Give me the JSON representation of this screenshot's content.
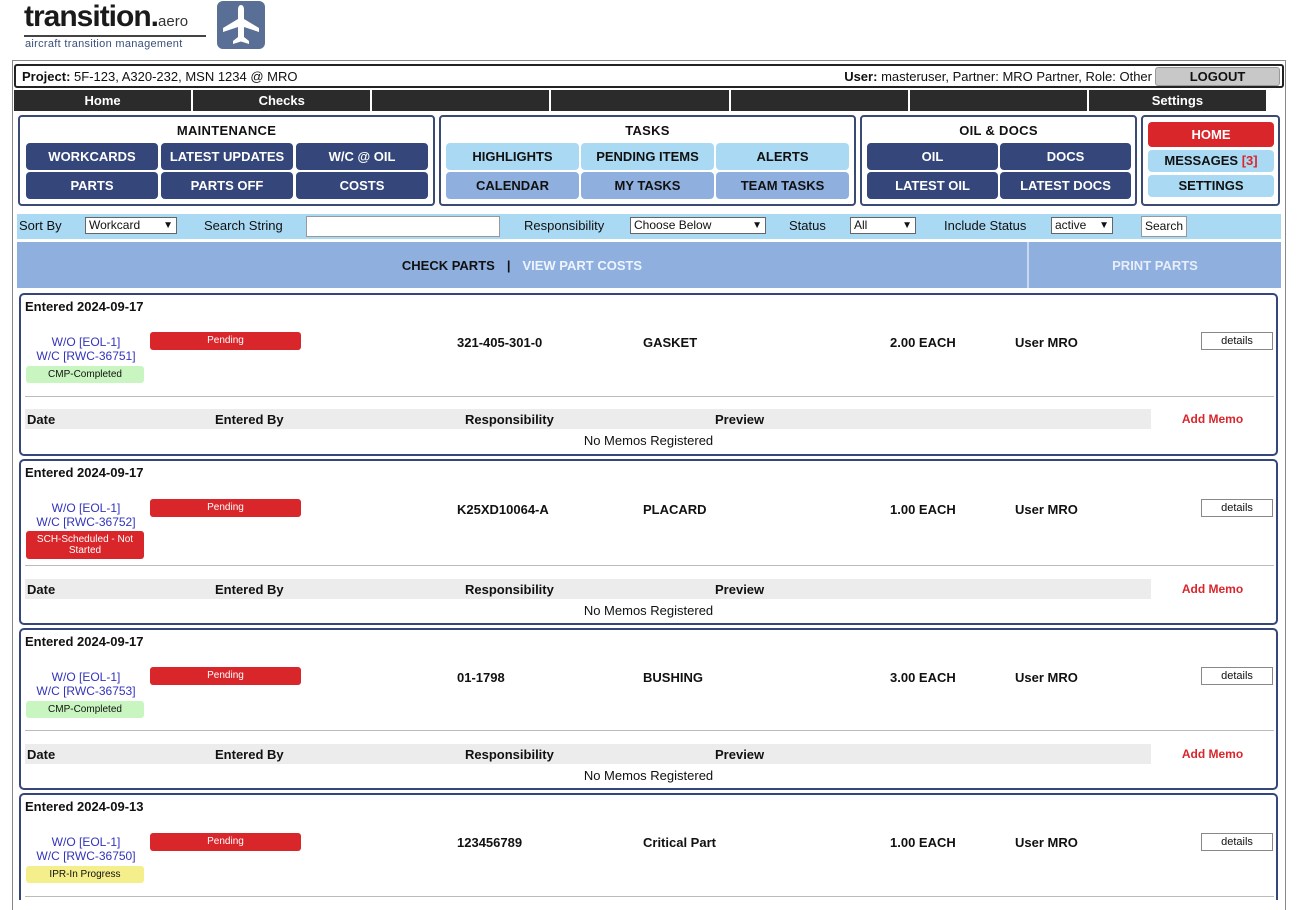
{
  "logo": {
    "word": "transition.",
    "suffix": "aero",
    "tagline": "aircraft transition management"
  },
  "project_bar": {
    "project_label": "Project:",
    "project_value": "5F-123, A320-232, MSN 1234 @ MRO",
    "user_label": "User:",
    "user_value": "masteruser, Partner: MRO Partner, Role: Other",
    "logout": "LOGOUT"
  },
  "nav": [
    "Home",
    "Checks",
    "",
    "",
    "",
    "",
    "Settings"
  ],
  "maintenance": {
    "title": "MAINTENANCE",
    "buttons": [
      "WORKCARDS",
      "LATEST UPDATES",
      "W/C @ OIL",
      "PARTS",
      "PARTS OFF",
      "COSTS"
    ]
  },
  "tasks": {
    "title": "TASKS",
    "buttons": [
      "HIGHLIGHTS",
      "PENDING ITEMS",
      "ALERTS",
      "CALENDAR",
      "MY TASKS",
      "TEAM TASKS"
    ]
  },
  "oil_docs": {
    "title": "OIL & DOCS",
    "buttons": [
      "OIL",
      "DOCS",
      "LATEST OIL",
      "LATEST DOCS"
    ]
  },
  "home_panel": {
    "home": "HOME",
    "messages": "MESSAGES",
    "messages_count": "[3]",
    "settings": "SETTINGS"
  },
  "filters": {
    "sort_by_label": "Sort By",
    "sort_by_value": "Workcard",
    "search_label": "Search String",
    "search_value": "",
    "responsibility_label": "Responsibility",
    "responsibility_value": "Choose Below",
    "status_label": "Status",
    "status_value": "All",
    "include_label": "Include Status",
    "include_value": "active",
    "search_button": "Search"
  },
  "tabs": {
    "check_parts": "CHECK PARTS",
    "separator": "|",
    "view_costs": "VIEW PART COSTS",
    "print_parts": "PRINT PARTS"
  },
  "memo_headers": {
    "date": "Date",
    "entered_by": "Entered By",
    "responsibility": "Responsibility",
    "preview": "Preview",
    "add_memo": "Add Memo",
    "no_memos": "No Memos Registered"
  },
  "parts": [
    {
      "entered": "Entered 2024-09-17",
      "wo": "W/O [EOL-1]",
      "wc": "W/C [RWC-36751]",
      "wc_status": "CMP-Completed",
      "wc_status_color": "green",
      "state": "Pending",
      "part_number": "321-405-301-0",
      "description": "GASKET",
      "quantity": "2.00 EACH",
      "user": "User MRO",
      "details": "details"
    },
    {
      "entered": "Entered 2024-09-17",
      "wo": "W/O [EOL-1]",
      "wc": "W/C [RWC-36752]",
      "wc_status": "SCH-Scheduled - Not Started",
      "wc_status_color": "red",
      "state": "Pending",
      "part_number": "K25XD10064-A",
      "description": "PLACARD",
      "quantity": "1.00 EACH",
      "user": "User MRO",
      "details": "details"
    },
    {
      "entered": "Entered 2024-09-17",
      "wo": "W/O [EOL-1]",
      "wc": "W/C [RWC-36753]",
      "wc_status": "CMP-Completed",
      "wc_status_color": "green",
      "state": "Pending",
      "part_number": "01-1798",
      "description": "BUSHING",
      "quantity": "3.00 EACH",
      "user": "User MRO",
      "details": "details"
    },
    {
      "entered": "Entered 2024-09-13",
      "wo": "W/O [EOL-1]",
      "wc": "W/C [RWC-36750]",
      "wc_status": "IPR-In Progress",
      "wc_status_color": "yellow",
      "state": "Pending",
      "part_number": "123456789",
      "description": "Critical Part",
      "quantity": "1.00 EACH",
      "user": "User MRO",
      "details": "details"
    }
  ]
}
